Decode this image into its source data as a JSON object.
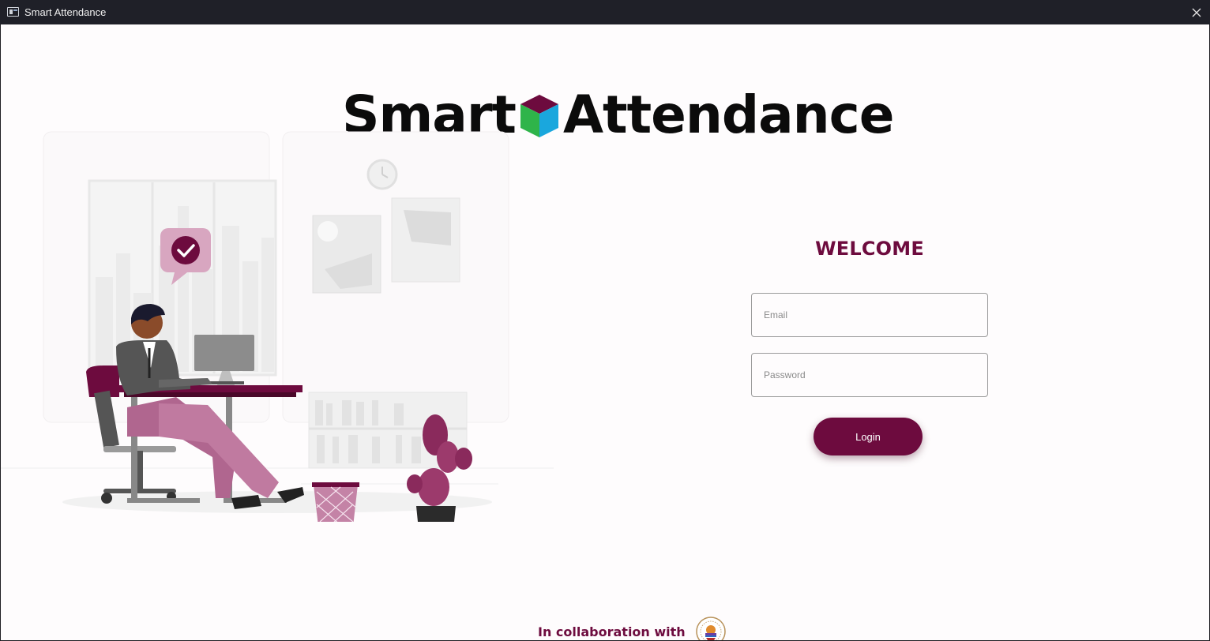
{
  "window": {
    "title": "Smart Attendance",
    "close_icon": "close-icon",
    "app_icon": "window-app-icon"
  },
  "logo": {
    "text_left": "Smart",
    "text_right": "Attendance",
    "cube_colors": {
      "top": "#6d0b3e",
      "left": "#2fb44a",
      "right": "#1aa7dd"
    }
  },
  "login": {
    "heading": "WELCOME",
    "email_placeholder": "Email",
    "email_value": "",
    "password_placeholder": "Password",
    "password_value": "",
    "button_label": "Login"
  },
  "footer": {
    "collab_text": "In collaboration with",
    "seal_icon": "university-seal-logo"
  },
  "colors": {
    "accent": "#6d0b3e",
    "accent_light": "#b4668f",
    "titlebar_bg": "#1f2028",
    "window_bg": "#fefcfd"
  }
}
